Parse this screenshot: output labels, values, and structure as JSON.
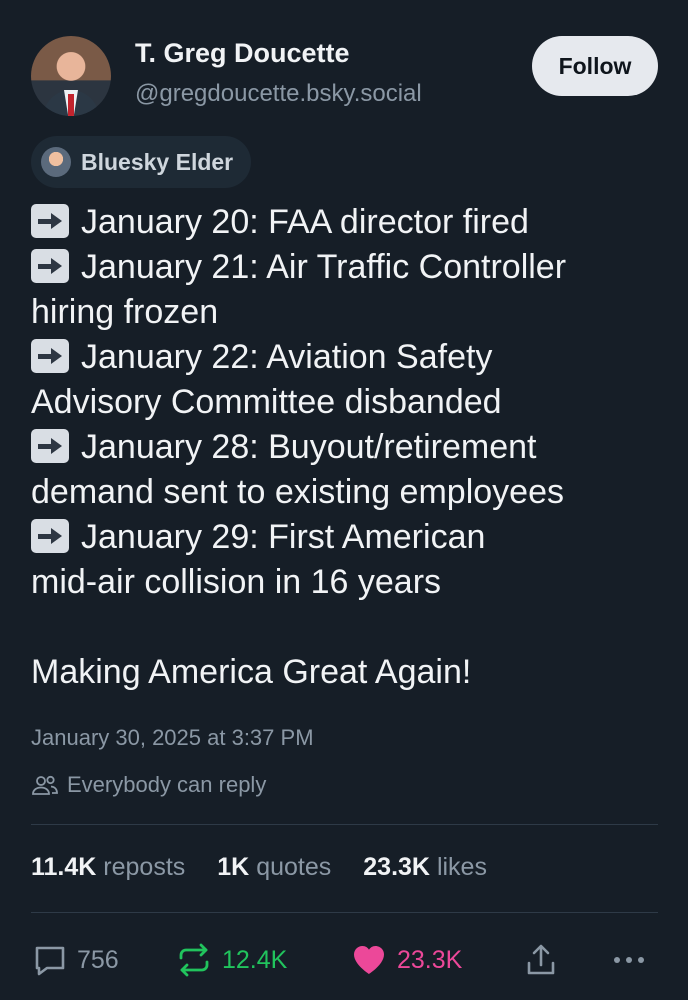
{
  "author": {
    "name": "T. Greg Doucette",
    "handle": "@gregdoucette.bsky.social",
    "follow_label": "Follow",
    "badge": "Bluesky Elder"
  },
  "post": {
    "lines": [
      {
        "arrow": true,
        "text": "January 20: FAA director fired"
      },
      {
        "arrow": true,
        "text": "January 21: Air Traffic Controller"
      },
      {
        "arrow": false,
        "text": "hiring frozen"
      },
      {
        "arrow": true,
        "text": "January 22: Aviation Safety"
      },
      {
        "arrow": false,
        "text": "Advisory Committee disbanded"
      },
      {
        "arrow": true,
        "text": "January 28: Buyout/retirement"
      },
      {
        "arrow": false,
        "text": "demand sent to existing employees"
      },
      {
        "arrow": true,
        "text": "January 29: First American"
      },
      {
        "arrow": false,
        "text": "mid-air collision in 16 years"
      }
    ],
    "closing": "Making America Great Again!",
    "timestamp": "January 30, 2025 at 3:37 PM",
    "reply_setting": "Everybody can reply"
  },
  "stats": {
    "reposts_count": "11.4K",
    "reposts_label": "reposts",
    "quotes_count": "1K",
    "quotes_label": "quotes",
    "likes_count": "23.3K",
    "likes_label": "likes"
  },
  "actions": {
    "replies": "756",
    "reposts": "12.4K",
    "likes": "23.3K",
    "icons": [
      "reply-icon",
      "repost-icon",
      "heart-icon",
      "share-icon",
      "more-icon"
    ]
  },
  "colors": {
    "background": "#161e27",
    "repost_green": "#21c45d",
    "like_pink": "#ec4899",
    "muted": "#8b98a5"
  }
}
